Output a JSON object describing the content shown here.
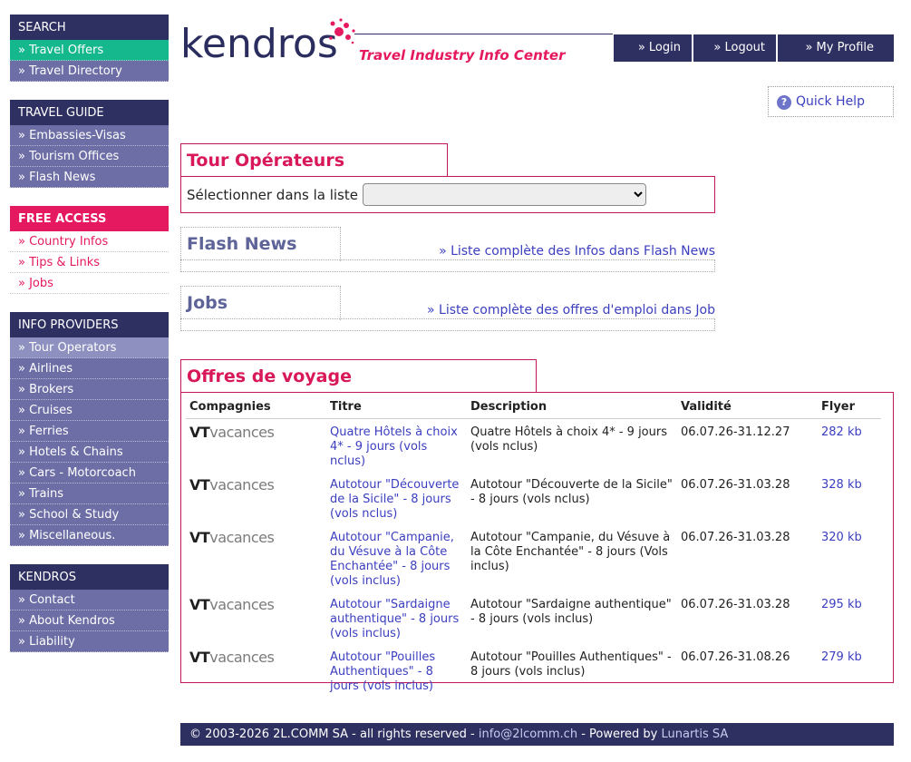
{
  "sidebar": {
    "search": {
      "title": "SEARCH",
      "items": [
        "» Travel Offers",
        "» Travel Directory"
      ]
    },
    "travel_guide": {
      "title": "TRAVEL GUIDE",
      "items": [
        "» Embassies-Visas",
        "» Tourism Offices",
        "» Flash News"
      ]
    },
    "free_access": {
      "title": "FREE ACCESS",
      "items": [
        "» Country Infos",
        "» Tips & Links",
        "» Jobs"
      ]
    },
    "info_providers": {
      "title": "INFO PROVIDERS",
      "items": [
        "» Tour Operators",
        "» Airlines",
        "» Brokers",
        "» Cruises",
        "» Ferries",
        "» Hotels & Chains",
        "» Cars - Motorcoach",
        "» Trains",
        "» School & Study",
        "» Miscellaneous."
      ]
    },
    "kendros": {
      "title": "KENDROS",
      "items": [
        "» Contact",
        "» About Kendros",
        "» Liability"
      ]
    }
  },
  "header": {
    "logo_word": "kendros",
    "tagline": "Travel Industry Info Center",
    "nav": {
      "login": "» Login",
      "logout": "» Logout",
      "profile": "» My Profile"
    },
    "quick_help": "Quick Help"
  },
  "tour_operateurs": {
    "title": "Tour Opérateurs",
    "select_label": "Sélectionner dans la liste",
    "select_value": ""
  },
  "flash_news": {
    "title": "Flash News",
    "link": "» Liste complète des Infos dans Flash News"
  },
  "jobs": {
    "title": "Jobs",
    "link": "» Liste complète des offres d'emploi dans Job"
  },
  "offres": {
    "title": "Offres de voyage",
    "columns": [
      "Compagnies",
      "Titre",
      "Description",
      "Validité",
      "Flyer"
    ],
    "company_logo": {
      "bold": "VT",
      "light": "vacances"
    },
    "rows": [
      {
        "titre": "Quatre Hôtels à choix 4* - 9 jours (vols nclus)",
        "description": "Quatre Hôtels à choix 4* - 9 jours (vols nclus)",
        "validite": "06.07.26-31.12.27",
        "flyer": "282 kb"
      },
      {
        "titre": "Autotour \"Découverte de la Sicile\" - 8 jours (vols nclus)",
        "description": "Autotour \"Découverte de la Sicile\" - 8 jours (vols nclus)",
        "validite": "06.07.26-31.03.28",
        "flyer": "328 kb"
      },
      {
        "titre": "Autotour \"Campanie, du Vésuve à la Côte Enchantée\" - 8 jours (vols inclus)",
        "description": "Autotour \"Campanie, du Vésuve à la Côte Enchantée\" - 8 jours (Vols inclus)",
        "validite": "06.07.26-31.03.28",
        "flyer": "320 kb"
      },
      {
        "titre": "Autotour \"Sardaigne authentique\" - 8 jours (vols inclus)",
        "description": "Autotour \"Sardaigne authentique\" - 8 jours (vols inclus)",
        "validite": "06.07.26-31.03.28",
        "flyer": "295 kb"
      },
      {
        "titre": "Autotour \"Pouilles Authentiques\" - 8 jours (vols inclus)",
        "description": "Autotour \"Pouilles Authentiques\" - 8 jours (vols inclus)",
        "validite": "06.07.26-31.08.26",
        "flyer": "279 kb"
      }
    ]
  },
  "footer": {
    "copyright": "© 2003-2026 2L.COMM SA - all rights reserved - ",
    "email": "info@2lcomm.ch",
    "powered": " - Powered by ",
    "powered_by": "Lunartis SA"
  },
  "colors": {
    "navy": "#2f3062",
    "sidebar_item": "#6d6ea6",
    "active_green": "#15b88d",
    "accent_pink": "#e5195f",
    "link_blue": "#3b3ebf"
  }
}
